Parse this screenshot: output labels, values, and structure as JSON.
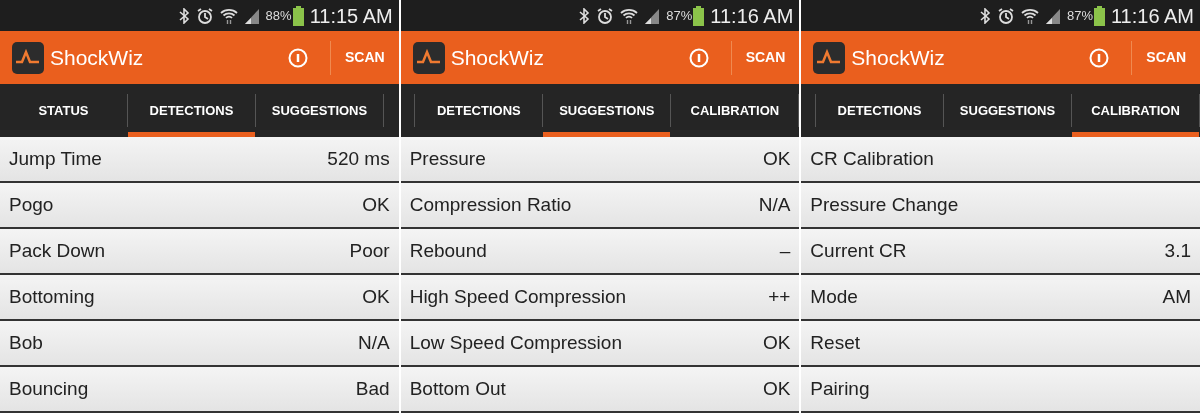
{
  "screens": [
    {
      "status_bar": {
        "battery": "88%",
        "time": "11:15 AM"
      },
      "app_bar": {
        "title": "ShockWiz",
        "action": "SCAN"
      },
      "tabs_scrolled": false,
      "tabs": [
        {
          "label": "STATUS",
          "selected": false
        },
        {
          "label": "DETECTIONS",
          "selected": true
        },
        {
          "label": "SUGGESTIONS",
          "selected": false
        }
      ],
      "rows": [
        {
          "label": "Jump Time",
          "value": "520 ms"
        },
        {
          "label": "Pogo",
          "value": "OK"
        },
        {
          "label": "Pack Down",
          "value": "Poor"
        },
        {
          "label": "Bottoming",
          "value": "OK"
        },
        {
          "label": "Bob",
          "value": "N/A"
        },
        {
          "label": "Bouncing",
          "value": "Bad"
        }
      ]
    },
    {
      "status_bar": {
        "battery": "87%",
        "time": "11:16 AM"
      },
      "app_bar": {
        "title": "ShockWiz",
        "action": "SCAN"
      },
      "tabs_scrolled": true,
      "tabs": [
        {
          "label": "DETECTIONS",
          "selected": false
        },
        {
          "label": "SUGGESTIONS",
          "selected": true
        },
        {
          "label": "CALIBRATION",
          "selected": false
        }
      ],
      "rows": [
        {
          "label": "Pressure",
          "value": "OK"
        },
        {
          "label": "Compression Ratio",
          "value": "N/A"
        },
        {
          "label": "Rebound",
          "value": "–"
        },
        {
          "label": "High Speed Compression",
          "value": "++"
        },
        {
          "label": "Low Speed Compression",
          "value": "OK"
        },
        {
          "label": "Bottom Out",
          "value": "OK"
        }
      ]
    },
    {
      "status_bar": {
        "battery": "87%",
        "time": "11:16 AM"
      },
      "app_bar": {
        "title": "ShockWiz",
        "action": "SCAN"
      },
      "tabs_scrolled": true,
      "tabs": [
        {
          "label": "DETECTIONS",
          "selected": false
        },
        {
          "label": "SUGGESTIONS",
          "selected": false
        },
        {
          "label": "CALIBRATION",
          "selected": true
        }
      ],
      "rows": [
        {
          "label": "CR Calibration"
        },
        {
          "label": "Pressure Change"
        },
        {
          "label": "Current CR",
          "value": "3.1"
        },
        {
          "label": "Mode",
          "value": "AM"
        },
        {
          "label": "Reset"
        },
        {
          "label": "Pairing"
        }
      ]
    }
  ]
}
